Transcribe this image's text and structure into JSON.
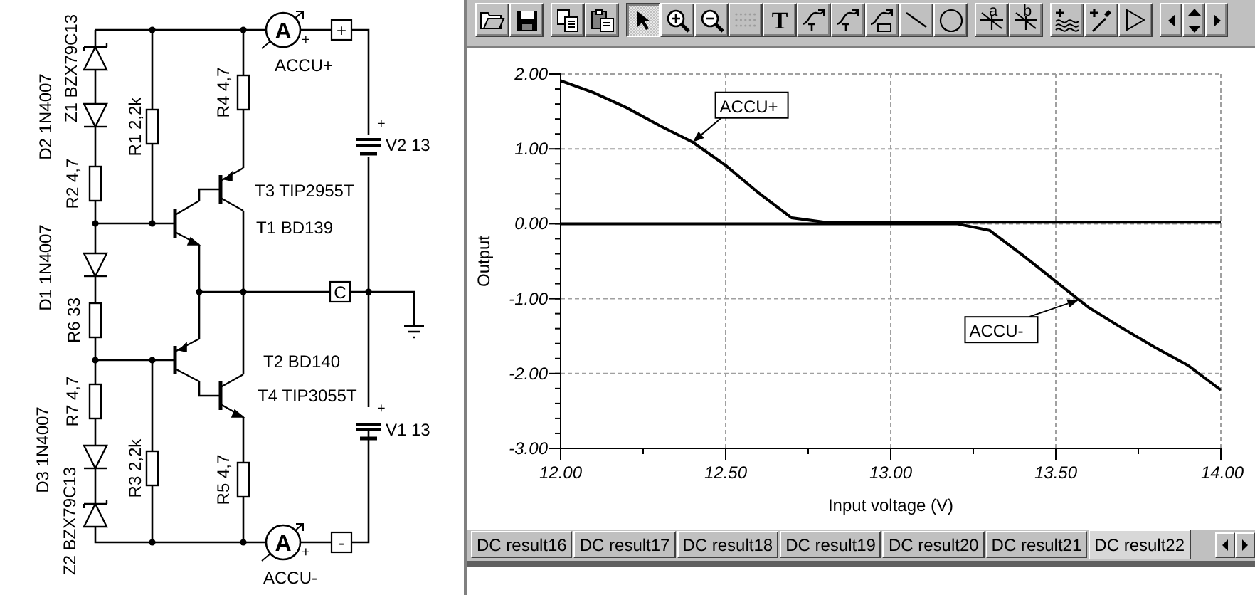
{
  "schematic": {
    "component_labels": [
      "Z1 BZX79C13",
      "D2 1N4007",
      "R2 4,7",
      "R1 2,2k",
      "R4 4,7",
      "T3 TIP2955T",
      "T1 BD139",
      "D1 1N4007",
      "R6 33",
      "T2 BD140",
      "T4 TIP3055T",
      "R7 4,7",
      "D3 1N4007",
      "R3 2,2k",
      "R5 4,7",
      "Z2 BZX79C13"
    ],
    "meters": [
      {
        "symbol": "A",
        "polarity": "+",
        "label": "ACCU+"
      },
      {
        "symbol": "A",
        "polarity": "+",
        "label": "ACCU-"
      }
    ],
    "terminals": [
      "+",
      "C",
      "-"
    ],
    "sources": [
      {
        "label": "V2 13",
        "polarity": "+"
      },
      {
        "label": "V1 13",
        "polarity": "+"
      }
    ]
  },
  "toolbar": [
    {
      "kind": "open",
      "selected": false,
      "disabled": false
    },
    {
      "kind": "save",
      "selected": false,
      "disabled": false
    },
    {
      "kind": "copy",
      "selected": false,
      "disabled": false
    },
    {
      "kind": "paste",
      "selected": false,
      "disabled": false
    },
    {
      "kind": "pointer",
      "selected": true,
      "disabled": false
    },
    {
      "kind": "zoom-in",
      "selected": false,
      "disabled": false
    },
    {
      "kind": "zoom-out",
      "selected": false,
      "disabled": false
    },
    {
      "kind": "grid",
      "selected": false,
      "disabled": true
    },
    {
      "kind": "text",
      "glyph": "T",
      "selected": false,
      "disabled": false
    },
    {
      "kind": "curve-text",
      "selected": false,
      "disabled": false
    },
    {
      "kind": "curve-query",
      "selected": false,
      "disabled": false
    },
    {
      "kind": "curve-formula",
      "selected": false,
      "disabled": false
    },
    {
      "kind": "line",
      "selected": false,
      "disabled": false
    },
    {
      "kind": "circle",
      "selected": false,
      "disabled": false
    },
    {
      "kind": "cursor",
      "glyph": "a",
      "selected": false,
      "disabled": false
    },
    {
      "kind": "cursor",
      "glyph": "b",
      "selected": false,
      "disabled": false
    },
    {
      "kind": "add-wave",
      "selected": false,
      "disabled": false
    },
    {
      "kind": "probe",
      "selected": false,
      "disabled": false
    },
    {
      "kind": "play",
      "selected": false,
      "disabled": false
    },
    {
      "kind": "nav-left",
      "selected": false,
      "disabled": false
    },
    {
      "kind": "nav-updown",
      "selected": false,
      "disabled": false
    },
    {
      "kind": "nav-right",
      "selected": false,
      "disabled": false
    }
  ],
  "chart": {
    "chart_data": {
      "type": "line",
      "xlabel": "Input voltage (V)",
      "ylabel": "Output",
      "x": [
        12.0,
        12.1,
        12.2,
        12.3,
        12.4,
        12.5,
        12.6,
        12.7,
        12.8,
        12.9,
        13.0,
        13.1,
        13.2,
        13.3,
        13.4,
        13.5,
        13.6,
        13.7,
        13.8,
        13.9,
        14.0
      ],
      "series": [
        {
          "name": "ACCU+",
          "color": "#000000",
          "values": [
            1.91,
            1.75,
            1.55,
            1.31,
            1.09,
            0.78,
            0.41,
            0.08,
            0.02,
            0.02,
            0.02,
            0.02,
            0.02,
            0.02,
            0.02,
            0.02,
            0.02,
            0.02,
            0.02,
            0.02,
            0.02
          ]
        },
        {
          "name": "ACCU-",
          "color": "#000000",
          "values": [
            0,
            0,
            0,
            0,
            0,
            0,
            0,
            0,
            0,
            0,
            0,
            0,
            0,
            -0.09,
            -0.42,
            -0.77,
            -1.12,
            -1.39,
            -1.65,
            -1.89,
            -2.22
          ]
        }
      ],
      "xlim": [
        12,
        14
      ],
      "ylim": [
        -3,
        2
      ],
      "xticks": [
        {
          "value": 12,
          "label": "12.00"
        },
        {
          "value": 12.5,
          "label": "12.50"
        },
        {
          "value": 13,
          "label": "13.00"
        },
        {
          "value": 13.5,
          "label": "13.50"
        },
        {
          "value": 14,
          "label": "14.00"
        }
      ],
      "yticks": [
        {
          "value": 2,
          "label": "2.00"
        },
        {
          "value": 1,
          "label": "1.00"
        },
        {
          "value": 0,
          "label": "0.00"
        },
        {
          "value": -1,
          "label": "-1.00"
        },
        {
          "value": -2,
          "label": "-2.00"
        },
        {
          "value": -3,
          "label": "-3.00"
        }
      ],
      "grid": true
    }
  },
  "tabs": [
    {
      "label": "DC result16",
      "selected": false
    },
    {
      "label": "DC result17",
      "selected": false
    },
    {
      "label": "DC result18",
      "selected": false
    },
    {
      "label": "DC result19",
      "selected": false
    },
    {
      "label": "DC result20",
      "selected": false
    },
    {
      "label": "DC result21",
      "selected": false
    },
    {
      "label": "DC result22",
      "selected": true
    }
  ]
}
